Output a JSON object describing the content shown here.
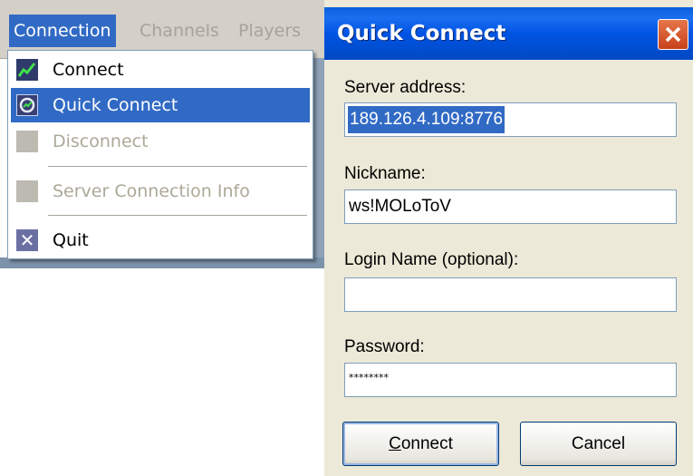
{
  "menubar": {
    "items": [
      "Connection",
      "Channels",
      "Players"
    ]
  },
  "connection_menu": {
    "items": [
      {
        "label": "Connect",
        "icon": "connect-icon",
        "state": "enabled"
      },
      {
        "label": "Quick Connect",
        "icon": "quick-connect-icon",
        "state": "highlighted"
      },
      {
        "label": "Disconnect",
        "icon": "disconnect-icon",
        "state": "disabled"
      },
      {
        "label": "Server Connection Info",
        "icon": "server-info-icon",
        "state": "disabled"
      },
      {
        "label": "Quit",
        "icon": "quit-icon",
        "state": "enabled"
      }
    ]
  },
  "dialog": {
    "title": "Quick Connect",
    "close_icon": "close-icon",
    "server_address_label": "Server address:",
    "server_address_value": "189.126.4.109:8776",
    "nickname_label": "Nickname:",
    "nickname_value": "ws!MOLoToV",
    "login_label": "Login Name (optional):",
    "login_value": "",
    "password_label": "Password:",
    "password_mask": "********",
    "connect_accel": "C",
    "connect_rest": "onnect",
    "cancel_label": "Cancel"
  },
  "colors": {
    "selection": "#316ac5",
    "titlebar": "#0054e3",
    "dialog_bg": "#ece9d8",
    "menubar_bg": "#d4d0c8",
    "close_button": "#d9582b"
  }
}
